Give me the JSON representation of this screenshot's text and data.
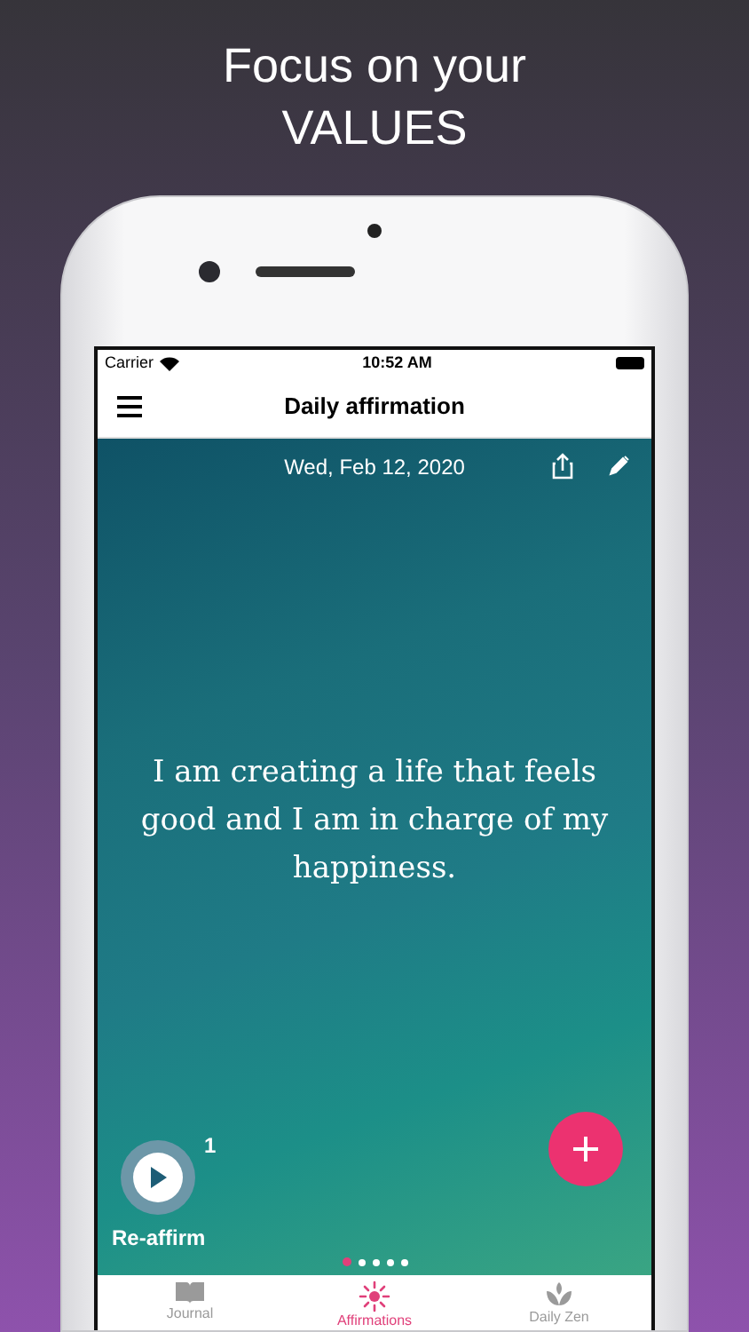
{
  "headline": [
    "Focus on your",
    "VALUES"
  ],
  "status_bar": {
    "carrier": "Carrier",
    "time": "10:52 AM"
  },
  "nav_bar": {
    "title": "Daily affirmation"
  },
  "card": {
    "date": "Wed, Feb 12, 2020",
    "text": "I am creating a life that feels good and I am in charge of my happiness.",
    "reaffirm_label": "Re-affirm",
    "reaffirm_count": "1"
  },
  "page_dots": [
    {
      "selected": true
    },
    {
      "selected": false
    },
    {
      "selected": false
    },
    {
      "selected": false
    },
    {
      "selected": false
    }
  ],
  "tabs": [
    {
      "label": "Journal",
      "kind": "book",
      "selected": false
    },
    {
      "label": "Affirmations",
      "kind": "sparkle",
      "selected": true
    },
    {
      "label": "Daily Zen",
      "kind": "lotus",
      "selected": false
    }
  ]
}
